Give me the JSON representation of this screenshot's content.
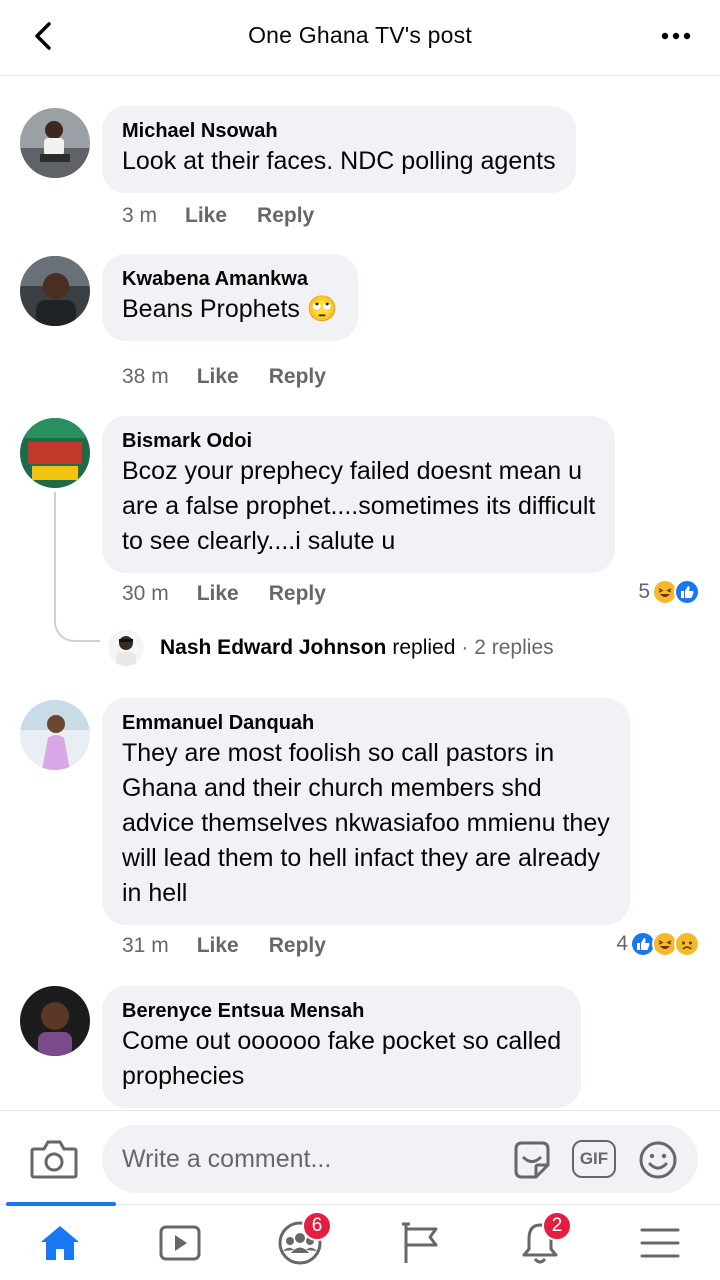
{
  "header": {
    "title": "One Ghana TV's post"
  },
  "comments": [
    {
      "author": "Michael Nsowah",
      "text_lines": [
        "Look at their faces. NDC polling agents"
      ],
      "time": "3 m",
      "like": "Like",
      "reply": "Reply"
    },
    {
      "author": "Kwabena Amankwa",
      "text_lines": [
        "Beans Prophets 🙄"
      ],
      "time": "38 m",
      "like": "Like",
      "reply": "Reply"
    },
    {
      "author": "Bismark Odoi",
      "text_lines": [
        "Bcoz your prephecy failed doesnt mean u",
        "are a false prophet....sometimes its difficult",
        "to see clearly....i salute u"
      ],
      "time": "30 m",
      "like": "Like",
      "reply": "Reply",
      "reaction_count": "5",
      "reactions": [
        "haha",
        "like"
      ],
      "replied": {
        "name": "Nash Edward Johnson",
        "verb": "replied",
        "count": "· 2 replies"
      }
    },
    {
      "author": "Emmanuel Danquah",
      "text_lines": [
        "They are most foolish so call pastors in",
        "Ghana and their church members shd",
        "advice themselves nkwasiafoo mmienu they",
        "will lead them to hell infact they are already",
        "in hell"
      ],
      "time": "31 m",
      "like": "Like",
      "reply": "Reply",
      "reaction_count": "4",
      "reactions": [
        "like",
        "haha",
        "sad"
      ]
    },
    {
      "author": "Berenyce Entsua Mensah",
      "text_lines": [
        "Come out oooooo fake pocket so called",
        "prophecies"
      ]
    }
  ],
  "composer": {
    "placeholder": "Write a comment...",
    "gif_label": "GIF"
  },
  "nav": {
    "groups_badge": "6",
    "notifications_badge": "2"
  },
  "colors": {
    "accent": "#1877f2",
    "bubble": "#f0f2f5",
    "muted": "#65676b",
    "badge": "#e41e3f"
  }
}
